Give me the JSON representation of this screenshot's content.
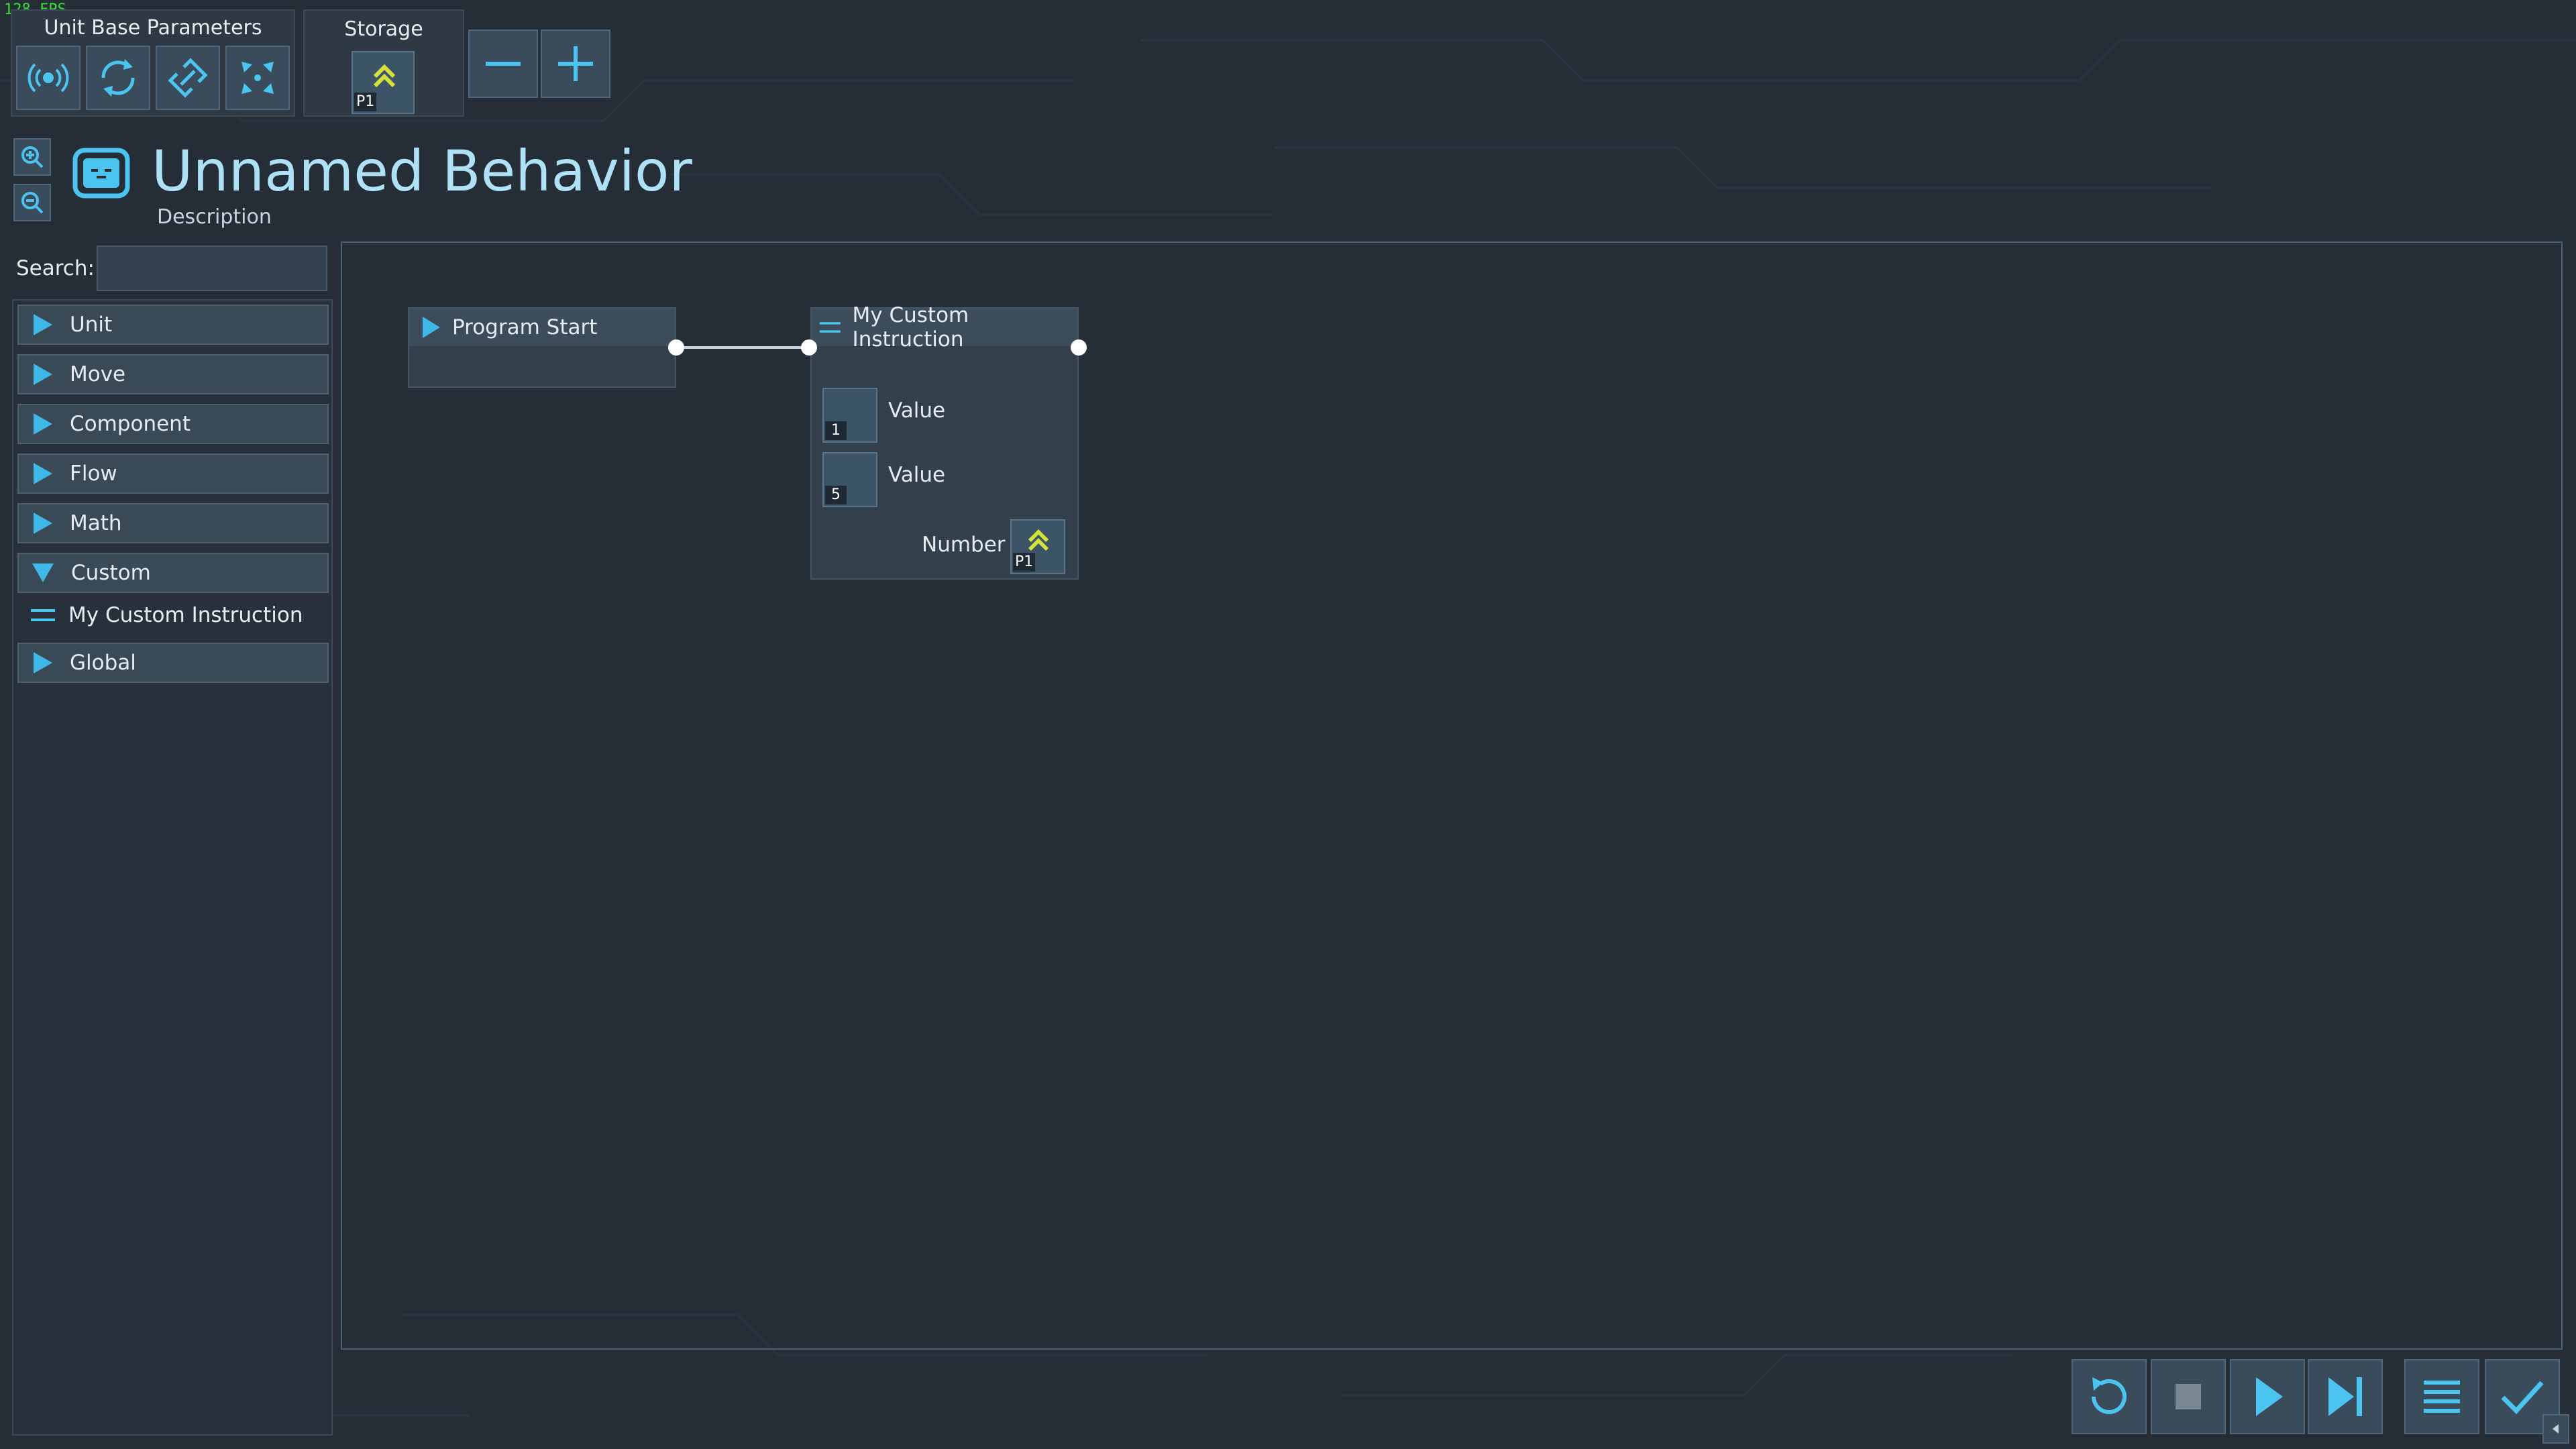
{
  "fps": "128 FPS",
  "toolbar": {
    "unit_base_label": "Unit Base Parameters",
    "unit_base_icons": [
      "signal-icon",
      "rotate-icon",
      "link-icon",
      "shrink-icon"
    ],
    "storage_label": "Storage",
    "storage_slot_badge": "P1",
    "minus_icon": "minus-icon",
    "plus_icon": "plus-icon"
  },
  "zoom": {
    "in_icon": "zoom-in-icon",
    "out_icon": "zoom-out-icon"
  },
  "behavior": {
    "title": "Unnamed Behavior",
    "description": "Description"
  },
  "search": {
    "label": "Search:",
    "value": ""
  },
  "sidebar": {
    "categories": [
      {
        "label": "Unit",
        "expanded": false
      },
      {
        "label": "Move",
        "expanded": false
      },
      {
        "label": "Component",
        "expanded": false
      },
      {
        "label": "Flow",
        "expanded": false
      },
      {
        "label": "Math",
        "expanded": false
      },
      {
        "label": "Custom",
        "expanded": true,
        "items": [
          "My Custom Instruction"
        ]
      },
      {
        "label": "Global",
        "expanded": false
      }
    ]
  },
  "nodes": {
    "program_start": {
      "label": "Program Start"
    },
    "custom_instruction": {
      "label": "My Custom Instruction",
      "params": [
        {
          "label": "Value",
          "badge": "1"
        },
        {
          "label": "Value",
          "badge": "5"
        },
        {
          "label": "Number",
          "badge": "P1"
        }
      ]
    }
  },
  "controls": [
    "restart-icon",
    "stop-icon",
    "play-icon",
    "step-icon",
    "list-icon",
    "confirm-icon"
  ],
  "colors": {
    "background": "#252d37",
    "accent": "#3fb8e8",
    "title": "#aee0f6",
    "storage_arrow": "#d4e13a"
  }
}
